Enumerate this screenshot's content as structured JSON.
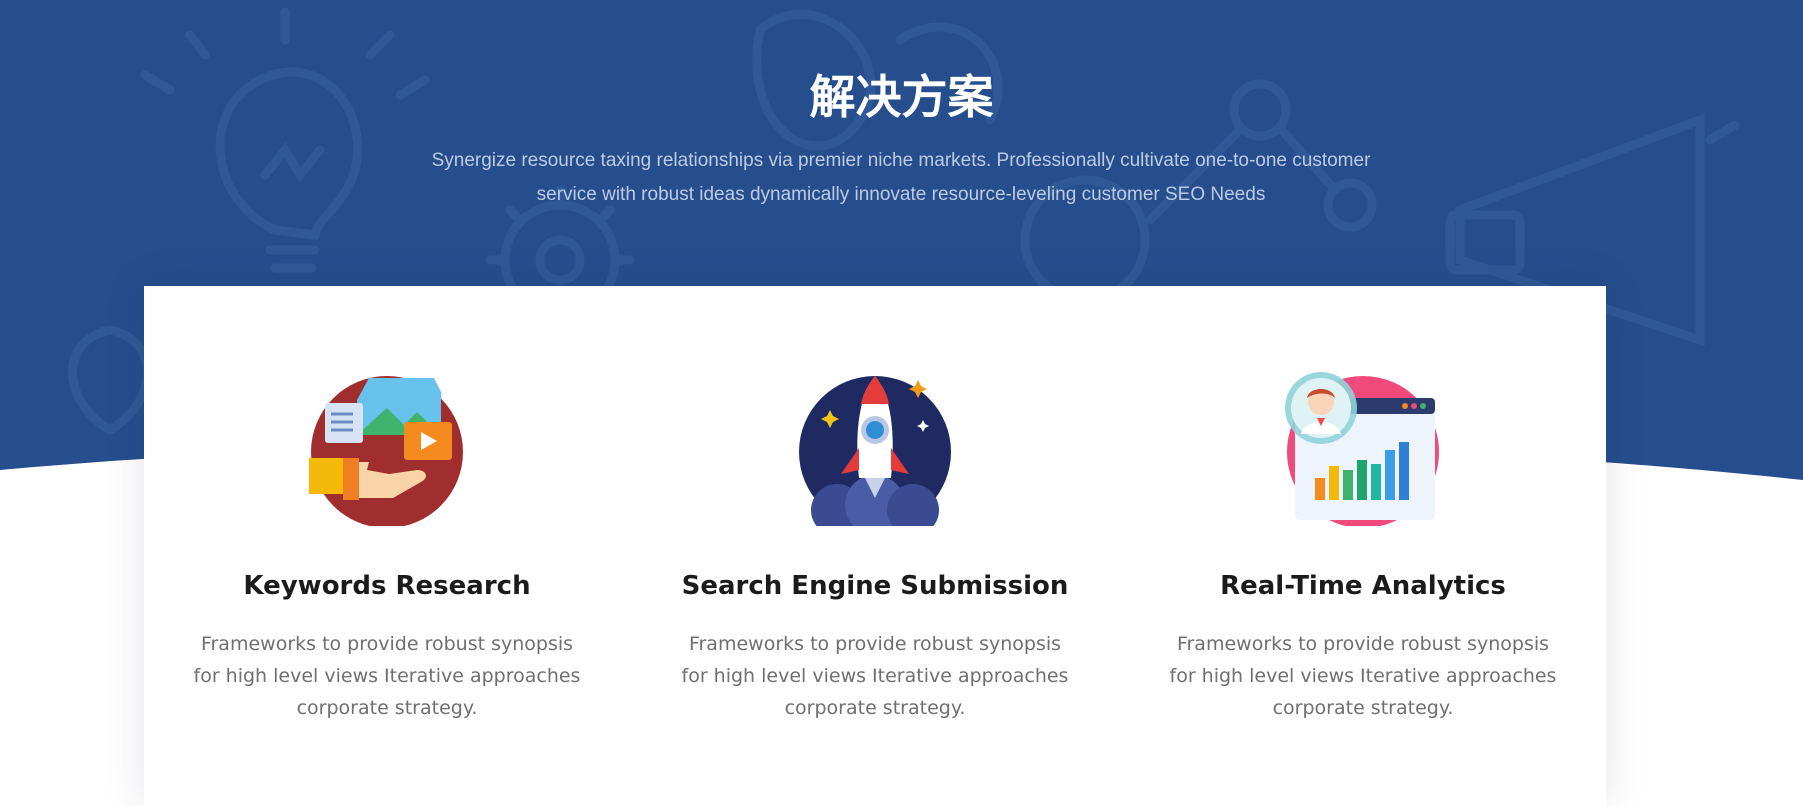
{
  "hero": {
    "title": "解决方案",
    "subtitle": "Synergize resource taxing relationships via premier niche markets. Professionally cultivate one-to-one customer service with robust ideas dynamically innovate resource-leveling customer SEO Needs"
  },
  "features": [
    {
      "title": "Keywords Research",
      "description": "Frameworks to provide robust synopsis for high level views Iterative approaches corporate strategy.",
      "icon": "hand-media-icon"
    },
    {
      "title": "Search Engine Submission",
      "description": "Frameworks to provide robust synopsis for high level views Iterative approaches corporate strategy.",
      "icon": "rocket-icon"
    },
    {
      "title": "Real-Time Analytics",
      "description": "Frameworks to provide robust synopsis for high level views Iterative approaches corporate strategy.",
      "icon": "analytics-chart-icon"
    }
  ],
  "colors": {
    "hero_background": "#264e8d",
    "title_text": "#ffffff",
    "heading_text": "#1b1b1b",
    "body_text": "#6f6f6f"
  }
}
